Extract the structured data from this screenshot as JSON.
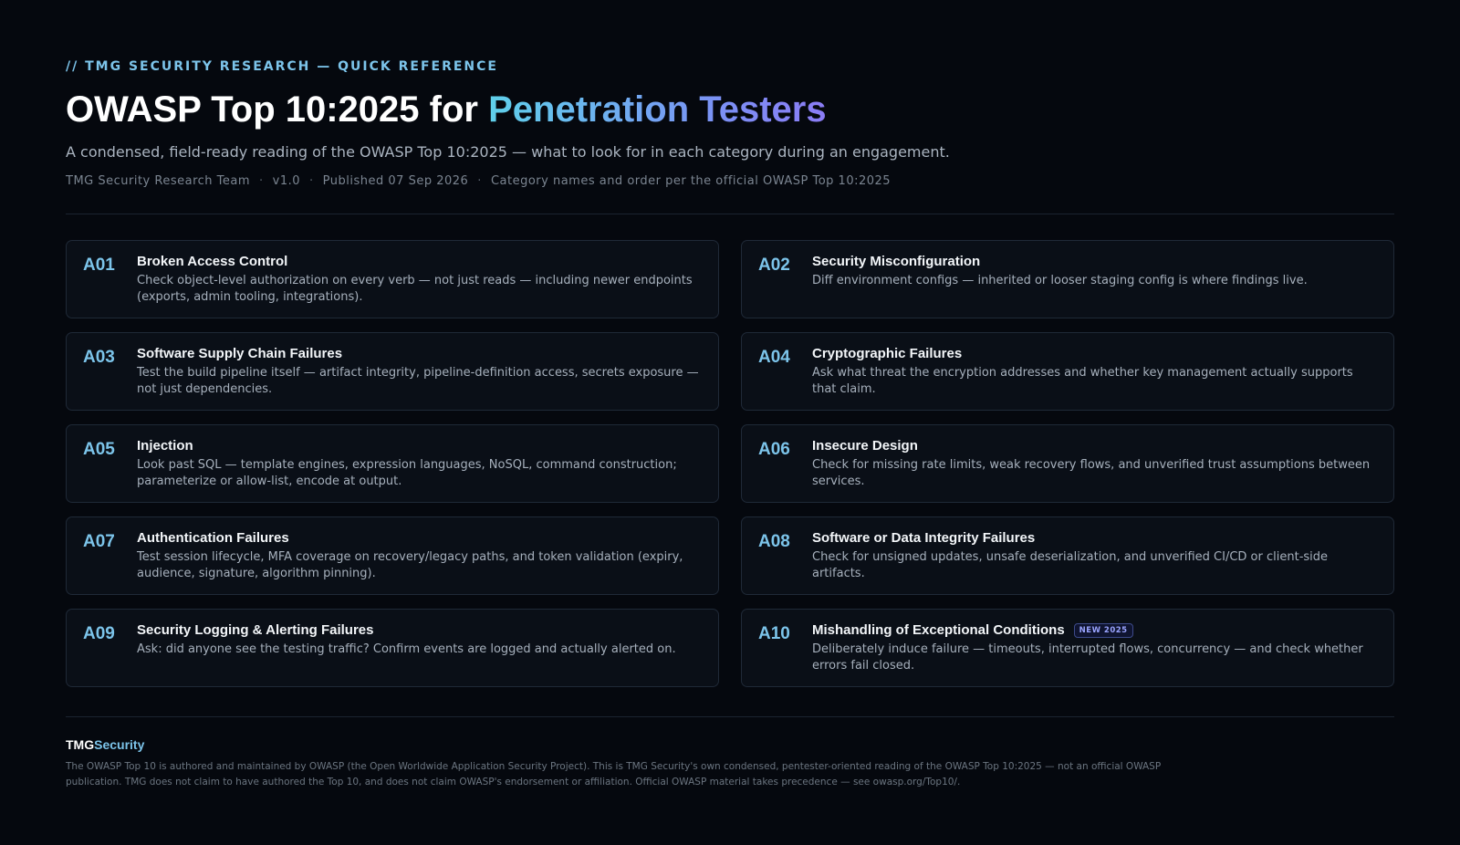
{
  "header": {
    "eyebrow": "// TMG SECURITY RESEARCH — QUICK REFERENCE",
    "title_main": "OWASP Top 10:2025 for ",
    "title_accent": "Penetration Testers",
    "subtitle": "A condensed, field-ready reading of the OWASP Top 10:2025 — what to look for in each category during an engagement.",
    "meta": {
      "team": "TMG Security Research Team",
      "version": "v1.0",
      "published": "Published 07 Sep 2026",
      "note": "Category names and order per the official OWASP Top 10:2025",
      "separator": "·"
    }
  },
  "categories": [
    {
      "code": "A01",
      "title": "Broken Access Control",
      "desc": "Check object-level authorization on every verb — not just reads — including newer endpoints (exports, admin tooling, integrations).",
      "badge": ""
    },
    {
      "code": "A02",
      "title": "Security Misconfiguration",
      "desc": "Diff environment configs — inherited or looser staging config is where findings live.",
      "badge": ""
    },
    {
      "code": "A03",
      "title": "Software Supply Chain Failures",
      "desc": "Test the build pipeline itself — artifact integrity, pipeline-definition access, secrets exposure — not just dependencies.",
      "badge": ""
    },
    {
      "code": "A04",
      "title": "Cryptographic Failures",
      "desc": "Ask what threat the encryption addresses and whether key management actually supports that claim.",
      "badge": ""
    },
    {
      "code": "A05",
      "title": "Injection",
      "desc": "Look past SQL — template engines, expression languages, NoSQL, command construction; parameterize or allow-list, encode at output.",
      "badge": ""
    },
    {
      "code": "A06",
      "title": "Insecure Design",
      "desc": "Check for missing rate limits, weak recovery flows, and unverified trust assumptions between services.",
      "badge": ""
    },
    {
      "code": "A07",
      "title": "Authentication Failures",
      "desc": "Test session lifecycle, MFA coverage on recovery/legacy paths, and token validation (expiry, audience, signature, algorithm pinning).",
      "badge": ""
    },
    {
      "code": "A08",
      "title": "Software or Data Integrity Failures",
      "desc": "Check for unsigned updates, unsafe deserialization, and unverified CI/CD or client-side artifacts.",
      "badge": ""
    },
    {
      "code": "A09",
      "title": "Security Logging & Alerting Failures",
      "desc": "Ask: did anyone see the testing traffic? Confirm events are logged and actually alerted on.",
      "badge": ""
    },
    {
      "code": "A10",
      "title": "Mishandling of Exceptional Conditions",
      "desc": "Deliberately induce failure — timeouts, interrupted flows, concurrency — and check whether errors fail closed.",
      "badge": "NEW 2025"
    }
  ],
  "footer": {
    "brand_a": "TMG",
    "brand_b": "Security",
    "disclaimer": "The OWASP Top 10 is authored and maintained by OWASP (the Open Worldwide Application Security Project). This is TMG Security's own condensed, pentester-oriented reading of the OWASP Top 10:2025 — not an official OWASP publication. TMG does not claim to have authored the Top 10, and does not claim OWASP's endorsement or affiliation. Official OWASP material takes precedence — see owasp.org/Top10/."
  },
  "colors": {
    "background": "#05080e",
    "accent": "#7cc4ea",
    "gradient_start": "#5fd0ea",
    "gradient_end": "#8b7cf5",
    "card_border": "#1f2937"
  }
}
